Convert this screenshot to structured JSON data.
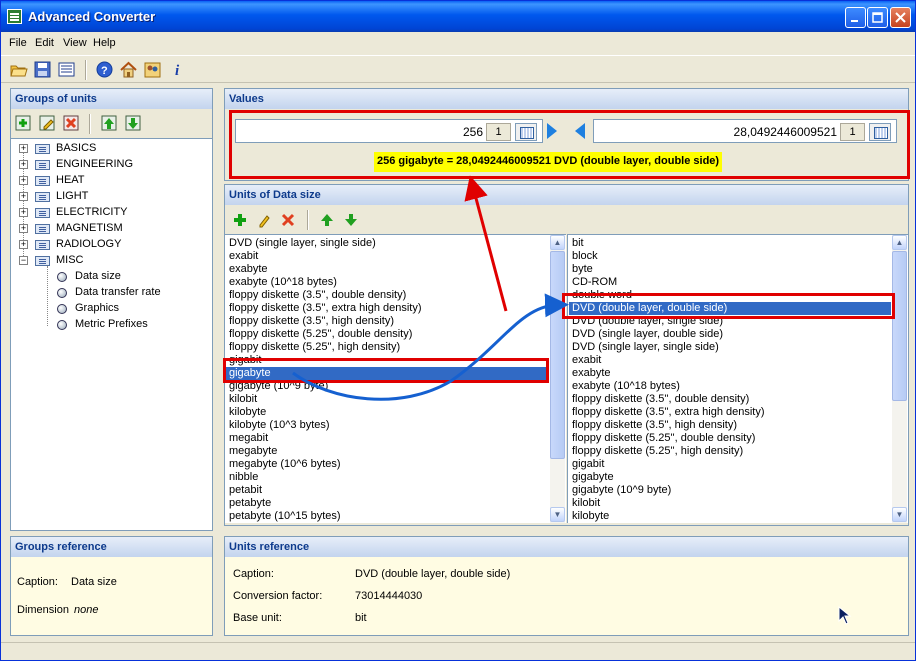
{
  "window": {
    "title": "Advanced Converter"
  },
  "menu": [
    "File",
    "Edit",
    "View",
    "Help"
  ],
  "toolbar_icons": [
    "open-folder-icon",
    "save-icon",
    "list-icon",
    "help-icon",
    "home-icon",
    "users-icon",
    "info-icon"
  ],
  "groups_panel": {
    "title": "Groups of units",
    "groups": [
      "BASICS",
      "ENGINEERING",
      "HEAT",
      "LIGHT",
      "ELECTRICITY",
      "MAGNETISM",
      "RADIOLOGY",
      "MISC"
    ],
    "misc_children": [
      "Data size",
      "Data transfer rate",
      "Graphics",
      "Metric Prefixes"
    ]
  },
  "groups_reference": {
    "title": "Groups reference",
    "caption_label": "Caption:",
    "caption_value": "Data size",
    "dimension_label": "Dimension",
    "dimension_value": "none"
  },
  "values_panel": {
    "title": "Values",
    "left_value": "256",
    "left_multiplier": "1",
    "right_value": "28,0492446009521",
    "right_multiplier": "1",
    "result": "256 gigabyte = 28,0492446009521 DVD (double layer, double side)"
  },
  "units_panel": {
    "title": "Units of Data size",
    "left_units": [
      "DVD (single layer, single side)",
      "exabit",
      "exabyte",
      "exabyte (10^18 bytes)",
      "floppy diskette (3.5'', double density)",
      "floppy diskette (3.5'', extra high density)",
      "floppy diskette (3.5'', high density)",
      "floppy diskette (5.25'', double density)",
      "floppy diskette (5.25'', high density)",
      "gigabit",
      "gigabyte",
      "gigabyte (10^9 byte)",
      "kilobit",
      "kilobyte",
      "kilobyte (10^3 bytes)",
      "megabit",
      "megabyte",
      "megabyte (10^6 bytes)",
      "nibble",
      "petabit",
      "petabyte",
      "petabyte (10^15 bytes)"
    ],
    "left_selected": "gigabyte",
    "right_units": [
      "bit",
      "block",
      "byte",
      "CD-ROM",
      "double word",
      "DVD (double layer, double side)",
      "DVD (double layer, single side)",
      "DVD (single layer, double side)",
      "DVD (single layer, single side)",
      "exabit",
      "exabyte",
      "exabyte (10^18 bytes)",
      "floppy diskette (3.5'', double density)",
      "floppy diskette (3.5'', extra high density)",
      "floppy diskette (3.5'', high density)",
      "floppy diskette (5.25'', double density)",
      "floppy diskette (5.25'', high density)",
      "gigabit",
      "gigabyte",
      "gigabyte (10^9 byte)",
      "kilobit",
      "kilobyte"
    ],
    "right_selected": "DVD (double layer, double side)"
  },
  "units_reference": {
    "title": "Units reference",
    "caption_label": "Caption:",
    "caption_value": "DVD (double layer, double side)",
    "factor_label": "Conversion factor:",
    "factor_value": "73014444030",
    "base_label": "Base unit:",
    "base_value": "bit"
  },
  "colors": {
    "title_bar": "#0058ee",
    "selection": "#316ac5",
    "highlight_box": "#e00000",
    "result_bg": "#ffff00",
    "arrow_red": "#e00000",
    "arrow_blue": "#1560d0",
    "reference_bg": "#fffce3"
  }
}
